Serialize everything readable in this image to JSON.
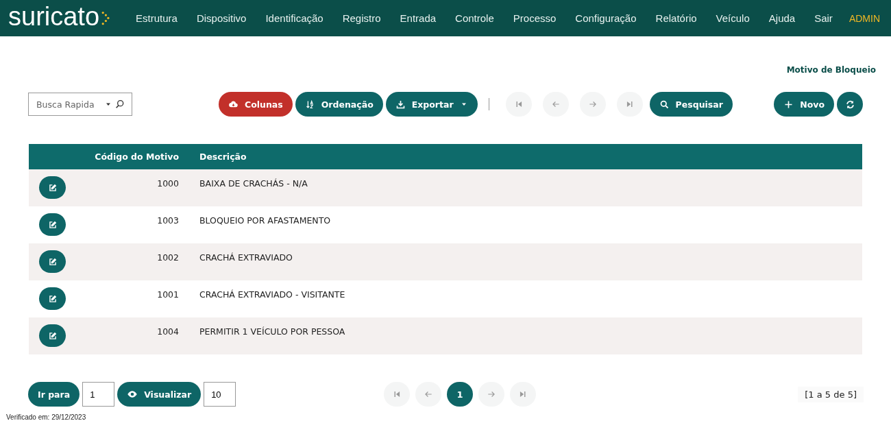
{
  "header": {
    "logo": "suricato",
    "nav": [
      "Estrutura",
      "Dispositivo",
      "Identificação",
      "Registro",
      "Entrada",
      "Controle",
      "Processo",
      "Configuração",
      "Relatório",
      "Veículo",
      "Ajuda",
      "Sair"
    ],
    "user": "ADMIN"
  },
  "page_title": "Motivo de Bloqueio",
  "quick_search": {
    "placeholder": "Busca Rapida"
  },
  "toolbar": [
    {
      "kind": "columns",
      "label": "Colunas",
      "color": "#c2302a"
    },
    {
      "kind": "sort",
      "label": "Ordenação",
      "color": "#0e6566"
    },
    {
      "kind": "export",
      "label": "Exportar",
      "color": "#0e6566"
    }
  ],
  "record_nav": [
    {
      "kind": "first",
      "disabled": true
    },
    {
      "kind": "prev",
      "disabled": true
    },
    {
      "kind": "next",
      "disabled": true
    },
    {
      "kind": "last",
      "disabled": true
    }
  ],
  "search_button": {
    "label": "Pesquisar"
  },
  "new_button": {
    "label": "Novo"
  },
  "table": {
    "columns": [
      "Código do Motivo",
      "Descrição"
    ],
    "rows": [
      {
        "code": "1000",
        "description": "BAIXA DE CRACHÁS - N/A"
      },
      {
        "code": "1003",
        "description": "BLOQUEIO POR AFASTAMENTO"
      },
      {
        "code": "1002",
        "description": "CRACHÁ EXTRAVIADO"
      },
      {
        "code": "1001",
        "description": "CRACHÁ EXTRAVIADO - VISITANTE"
      },
      {
        "code": "1004",
        "description": "PERMITIR 1 VEÍCULO POR PESSOA"
      }
    ]
  },
  "footer": {
    "goto": {
      "label": "Ir para",
      "value": "1"
    },
    "view": {
      "label": "Visualizar",
      "value": "10"
    },
    "pager": [
      {
        "kind": "first",
        "disabled": true
      },
      {
        "kind": "prev",
        "disabled": true
      },
      {
        "kind": "page",
        "label": "1",
        "selected": true
      },
      {
        "kind": "next",
        "disabled": true
      },
      {
        "kind": "last",
        "disabled": true
      }
    ],
    "summary": "[1 a 5 de 5]",
    "verified": "Verificado em: 29/12/2023"
  }
}
